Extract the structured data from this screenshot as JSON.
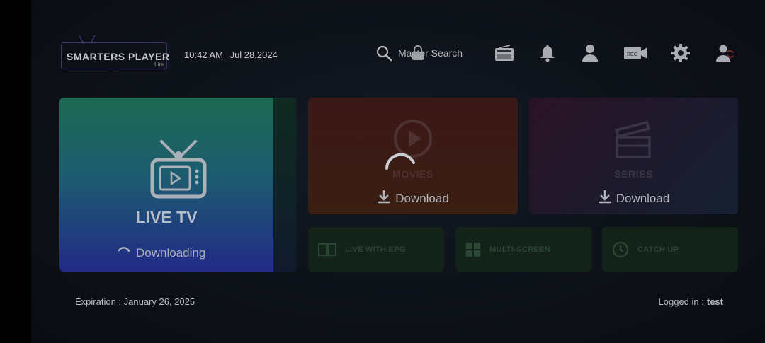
{
  "brand": {
    "name": "SMARTERS PLAYER",
    "sub": "Lite"
  },
  "header": {
    "time": "10:42 AM",
    "date": "Jul 28,2024",
    "search_label": "Master Search",
    "icons": [
      "search-icon",
      "lock-icon",
      "radio-icon",
      "bell-icon",
      "profile-icon",
      "record-icon",
      "settings-icon",
      "switch-user-icon"
    ]
  },
  "tiles": {
    "live": {
      "title": "LIVE TV",
      "status": "Downloading"
    },
    "movies": {
      "title": "MOVIES",
      "status": "Download"
    },
    "series": {
      "title": "SERIES",
      "status": "Download"
    },
    "small": [
      {
        "label": "LIVE WITH EPG",
        "icon": "book-icon"
      },
      {
        "label": "MULTI-SCREEN",
        "icon": "grid-icon"
      },
      {
        "label": "CATCH UP",
        "icon": "clock-icon"
      }
    ]
  },
  "footer": {
    "expiration": "Expiration : January 26, 2025",
    "logged_label": "Logged in :",
    "user": "test"
  },
  "colors": {
    "live_top": "#1c6a52",
    "live_bottom": "#222a86",
    "movies_bg": "#3c1718",
    "series_bg": "#1c1a2c",
    "small_bg": "#142319"
  }
}
